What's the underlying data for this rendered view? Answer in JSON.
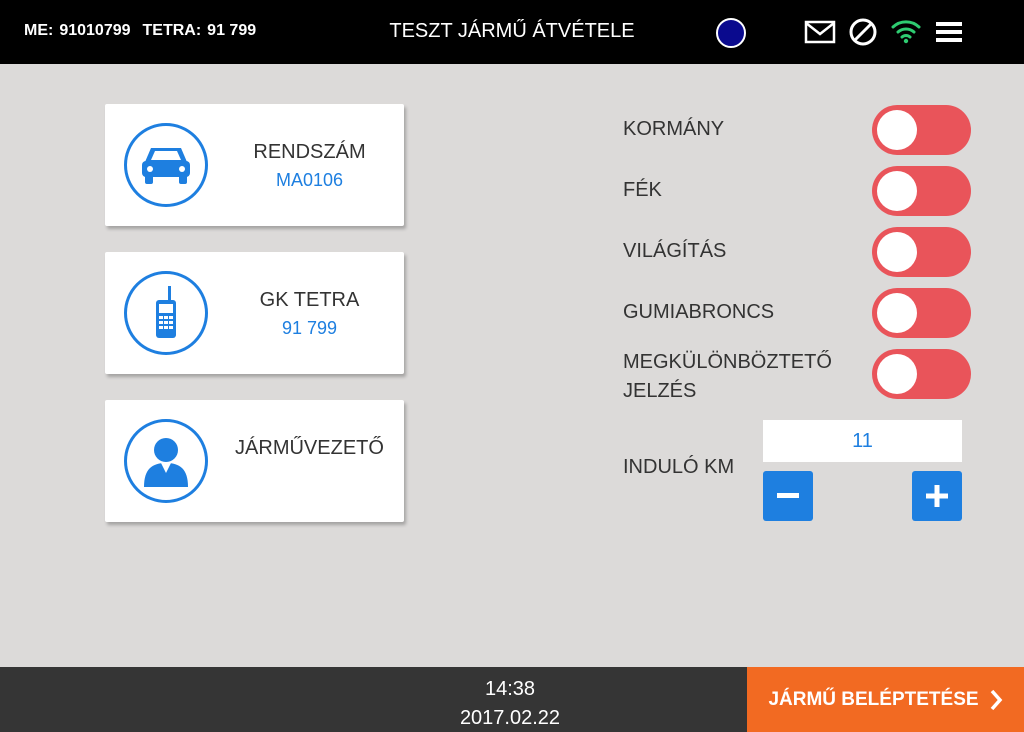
{
  "header": {
    "me_label": "ME:",
    "me_value": "91010799",
    "tetra_label": "TETRA:",
    "tetra_value": "91 799",
    "title": "TESZT JÁRMŰ ÁTVÉTELE",
    "status_color": "#0a0a8e",
    "icons": [
      "mail-icon",
      "block-icon",
      "wifi-icon",
      "menu-icon"
    ]
  },
  "cards": [
    {
      "label": "RENDSZÁM",
      "value": "MA0106",
      "icon": "car-icon"
    },
    {
      "label": "GK TETRA",
      "value": "91 799",
      "icon": "radio-icon"
    },
    {
      "label": "JÁRMŰVEZETŐ",
      "value": "",
      "icon": "driver-icon"
    }
  ],
  "checks": [
    {
      "label": "KORMÁNY",
      "on": false
    },
    {
      "label": "FÉK",
      "on": false
    },
    {
      "label": "VILÁGÍTÁS",
      "on": false
    },
    {
      "label": "GUMIABRONCS",
      "on": false
    },
    {
      "label": "MEGKÜLÖNBÖZTETŐ JELZÉS",
      "on": false
    }
  ],
  "km": {
    "label": "INDULÓ KM",
    "value": "11"
  },
  "footer": {
    "time": "14:38",
    "date": "2017.02.22",
    "submit_label": "JÁRMŰ BELÉPTETÉSE"
  },
  "colors": {
    "accent": "#1e7fe0",
    "toggle_off": "#e9545a",
    "submit": "#f26a22",
    "wifi": "#2ecc71"
  }
}
